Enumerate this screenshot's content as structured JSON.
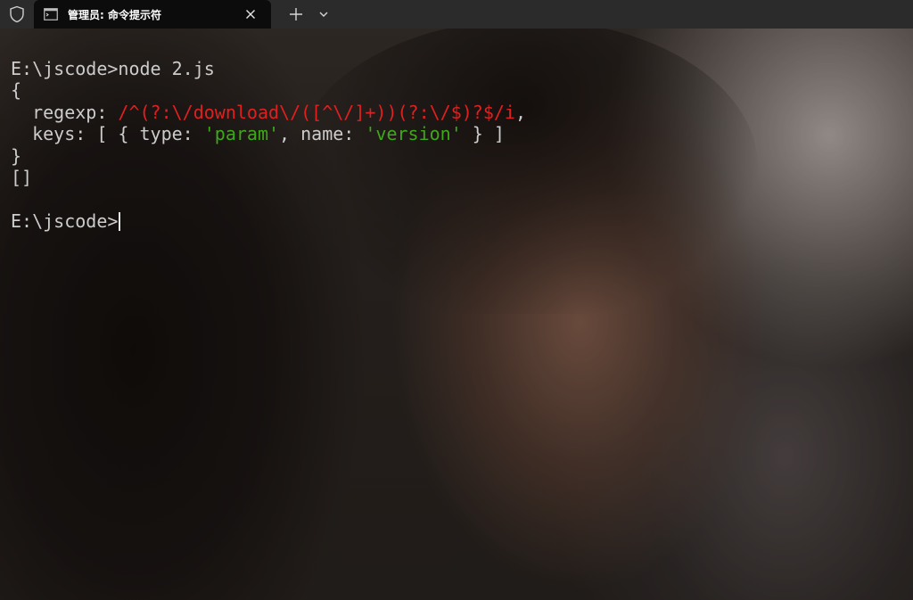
{
  "tab": {
    "title": "管理员: 命令提示符"
  },
  "terminal": {
    "prompt1": "E:\\jscode>",
    "command": "node 2.js",
    "open_brace": "{",
    "regexp_key": "  regexp: ",
    "regexp_value": "/^(?:\\/download\\/([^\\/]+))(?:\\/$)?$/i",
    "regexp_comma": ",",
    "keys_prefix": "  keys: [ { type: ",
    "type_value": "'param'",
    "name_sep": ", name: ",
    "name_value": "'version'",
    "keys_suffix": " } ]",
    "close_brace": "}",
    "empty_array": "[]",
    "prompt2": "E:\\jscode>"
  },
  "colors": {
    "string": "#3fa81a",
    "regexp": "#e02020",
    "text": "#cccccc"
  }
}
